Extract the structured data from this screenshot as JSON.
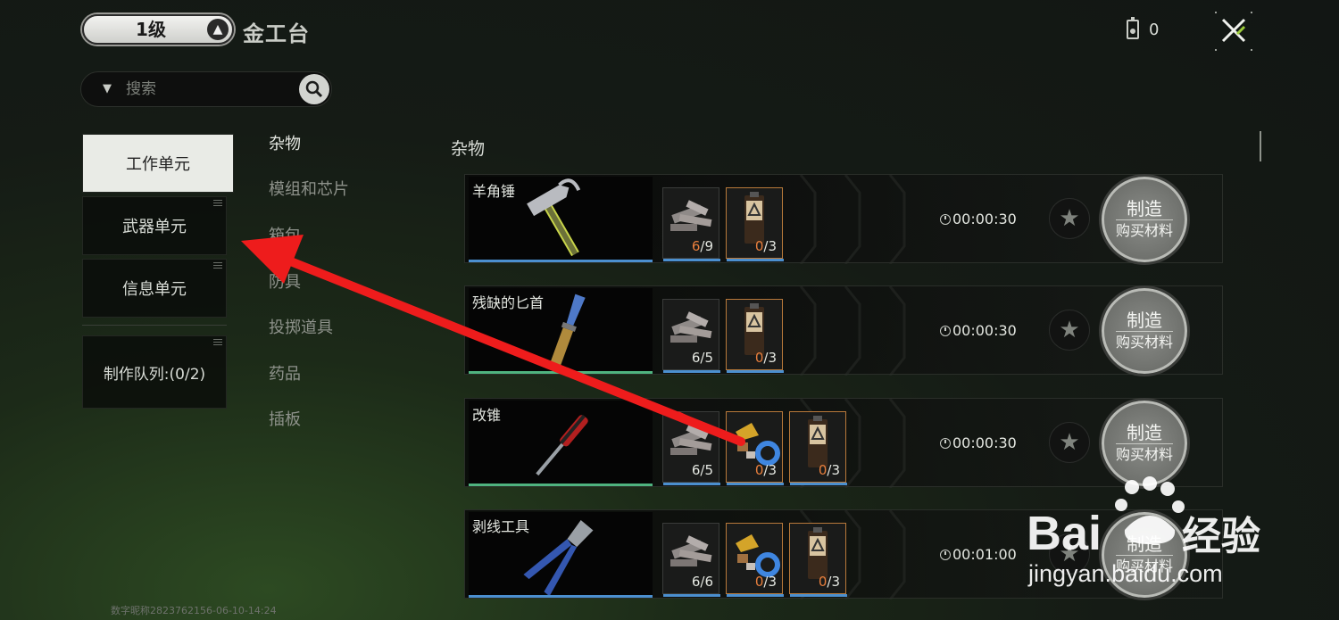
{
  "header": {
    "level": "1级",
    "bench_name": "金工台",
    "currency_value": "0"
  },
  "search": {
    "placeholder": "搜索"
  },
  "units": [
    {
      "label": "工作单元",
      "active": true
    },
    {
      "label": "武器单元",
      "active": false
    },
    {
      "label": "信息单元",
      "active": false
    }
  ],
  "queue": {
    "label": "制作队列:(0/2)"
  },
  "categories": [
    {
      "label": "杂物",
      "active": true
    },
    {
      "label": "模组和芯片",
      "active": false
    },
    {
      "label": "箱包",
      "active": false
    },
    {
      "label": "防具",
      "active": false
    },
    {
      "label": "投掷道具",
      "active": false
    },
    {
      "label": "药品",
      "active": false
    },
    {
      "label": "插板",
      "active": false
    }
  ],
  "section": {
    "title": "杂物"
  },
  "recipes": [
    {
      "name": "羊角锤",
      "icon": "hammer-icon",
      "bar_color": "#4b8fcf",
      "materials": [
        {
          "icon": "scrap-metal-icon",
          "have": "6",
          "need": "9"
        },
        {
          "icon": "fuel-canister-icon",
          "have": "0",
          "need": "3"
        }
      ],
      "time": "00:00:30",
      "craft_label": "制造",
      "buy_label": "购买材料"
    },
    {
      "name": "残缺的匕首",
      "icon": "dagger-icon",
      "bar_color": "#4fb37f",
      "materials": [
        {
          "icon": "scrap-metal-icon",
          "have": "6",
          "need": "5"
        },
        {
          "icon": "fuel-canister-icon",
          "have": "0",
          "need": "3"
        }
      ],
      "time": "00:00:30",
      "craft_label": "制造",
      "buy_label": "购买材料"
    },
    {
      "name": "改锥",
      "icon": "screwdriver-icon",
      "bar_color": "#4fb37f",
      "materials": [
        {
          "icon": "scrap-metal-icon",
          "have": "6",
          "need": "5"
        },
        {
          "icon": "electronic-parts-icon",
          "have": "0",
          "need": "3"
        },
        {
          "icon": "fuel-canister-icon",
          "have": "0",
          "need": "3"
        }
      ],
      "time": "00:00:30",
      "craft_label": "制造",
      "buy_label": "购买材料"
    },
    {
      "name": "剥线工具",
      "icon": "wire-stripper-icon",
      "bar_color": "#4b8fcf",
      "materials": [
        {
          "icon": "scrap-metal-icon",
          "have": "6",
          "need": "6"
        },
        {
          "icon": "electronic-parts-icon",
          "have": "0",
          "need": "3"
        },
        {
          "icon": "fuel-canister-icon",
          "have": "0",
          "need": "3"
        }
      ],
      "time": "00:01:00",
      "craft_label": "制造",
      "buy_label": "购买材料"
    }
  ],
  "footer": {
    "watermark": "数字昵称2823762156-06-10-14:24"
  },
  "overlay": {
    "logo_text": "Bai 经验",
    "logo_url": "jingyan.baidu.com"
  }
}
